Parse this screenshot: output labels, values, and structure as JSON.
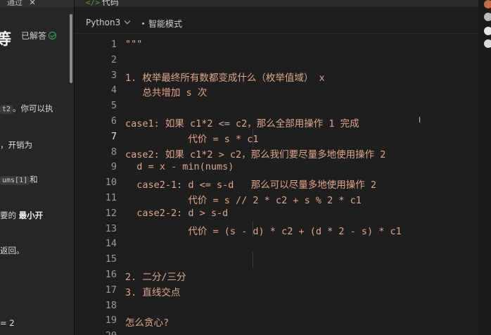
{
  "left_panel": {
    "tab_label": "通过",
    "tab_close": "✕",
    "title": "等",
    "solved_label": "已解答",
    "lines": [
      {
        "pre": "",
        "chip": "t2",
        "post": "。你可以执"
      },
      {
        "pre": "，开销为",
        "chip": "",
        "post": ""
      },
      {
        "pre": "",
        "chip": "ums[1]",
        "post": "和"
      },
      {
        "pre": "要的 ",
        "bold": "最小开",
        "chip": "",
        "post": ""
      },
      {
        "pre": "返回。",
        "chip": "",
        "post": ""
      },
      {
        "pre": "= 2",
        "chip": "",
        "post": ""
      }
    ]
  },
  "editor": {
    "header_label": "代码",
    "header_icon": "</>",
    "language": "Python3",
    "mode": "智能模式",
    "cursor_glyph": "I",
    "lines": [
      {
        "no": "1",
        "text": "\"\"\""
      },
      {
        "no": "2",
        "text": ""
      },
      {
        "no": "3",
        "text": "1. 枚举最终所有数都变成什么（枚举值域） x"
      },
      {
        "no": "4",
        "text": "   总共增加 s 次"
      },
      {
        "no": "5",
        "text": ""
      },
      {
        "no": "6",
        "text": "case1: 如果 c1*2 <= c2，那么全部用操作 1 完成"
      },
      {
        "no": "7",
        "text": "           代价 = s * c1"
      },
      {
        "no": "8",
        "text": "case2: 如果 c1*2 > c2，那么我们要尽量多地使用操作 2"
      },
      {
        "no": "9",
        "text": "  d = x - min(nums)"
      },
      {
        "no": "10",
        "text": "  case2-1: d <= s-d   那么可以尽量多地使用操作 2"
      },
      {
        "no": "11",
        "text": "           代价 = s // 2 * c2 + s % 2 * c1"
      },
      {
        "no": "12",
        "text": "  case2-2: d > s-d"
      },
      {
        "no": "13",
        "text": "           代价 = (s - d) * c2 + (d * 2 - s) * c1"
      },
      {
        "no": "14",
        "text": ""
      },
      {
        "no": "15",
        "text": ""
      },
      {
        "no": "16",
        "text": "2. 二分/三分"
      },
      {
        "no": "17",
        "text": "3. 直线交点"
      },
      {
        "no": "18",
        "text": ""
      },
      {
        "no": "19",
        "text": "怎么贪心?"
      },
      {
        "no": "20",
        "text": ""
      }
    ],
    "active_line": "7"
  },
  "colors": {
    "code_text": "#e1a488",
    "background": "#1e1e1e",
    "accent_green": "#2db55d"
  }
}
